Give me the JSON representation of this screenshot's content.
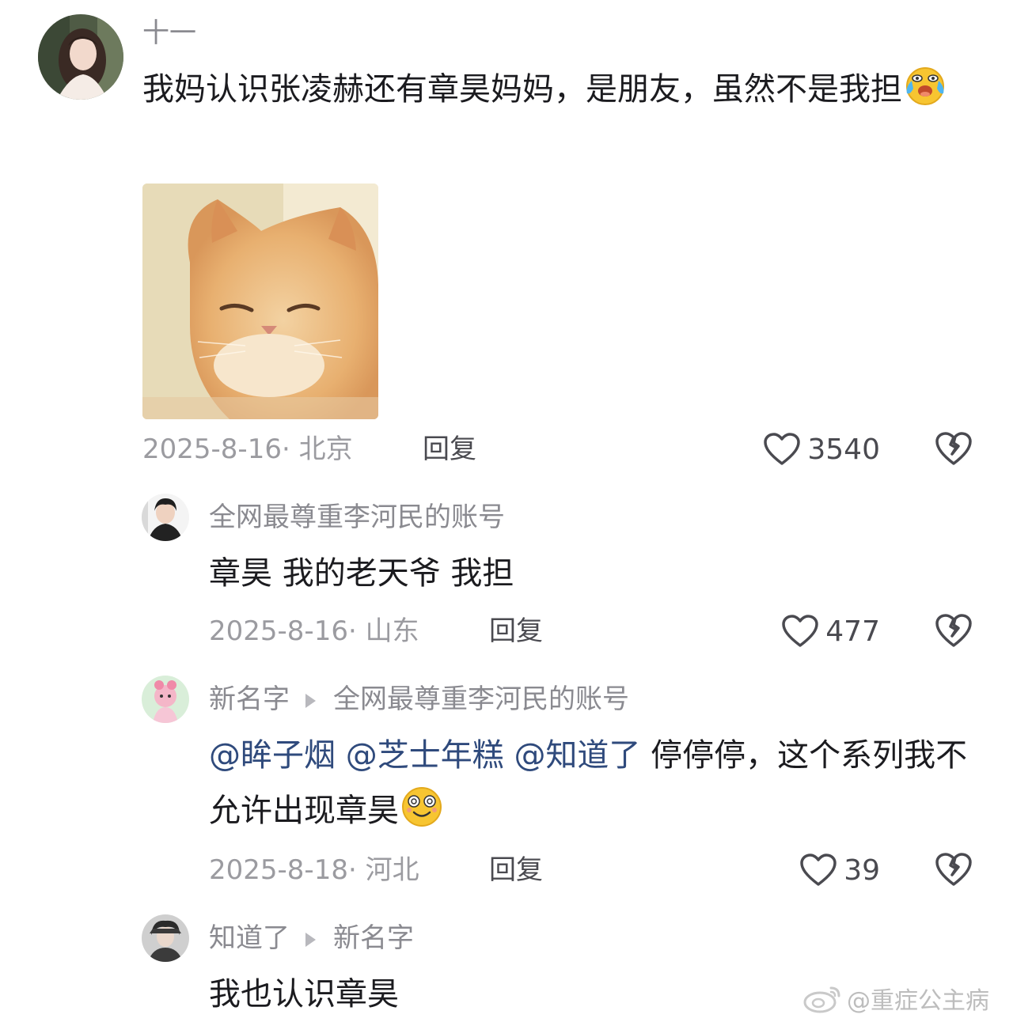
{
  "comments": [
    {
      "username": "十一",
      "text": "我妈认识张凌赫还有章昊妈妈，是朋友，虽然不是我担",
      "emoji": "crying-laughing-emoji",
      "date": "2025-8-16",
      "location": "北京",
      "reply_label": "回复",
      "likes": "3540",
      "image": "orange-cat-squinting-photo"
    },
    {
      "username": "全网最尊重李河民的账号",
      "text": "章昊 我的老天爷 我担",
      "date": "2025-8-16",
      "location": "山东",
      "reply_label": "回复",
      "likes": "477"
    },
    {
      "username": "新名字",
      "reply_to": "全网最尊重李河民的账号",
      "mentions": [
        "@眸子烟",
        "@芝士年糕",
        "@知道了"
      ],
      "text": "停停停，这个系列我不允许出现章昊",
      "emoji": "dizzy-smile-emoji",
      "date": "2025-8-18",
      "location": "河北",
      "reply_label": "回复",
      "likes": "39"
    },
    {
      "username": "知道了",
      "reply_to": "新名字",
      "text": "我也认识章昊"
    }
  ],
  "watermark": "@重症公主病",
  "icons": {
    "like": "heart-outline-icon",
    "dislike": "broken-heart-icon",
    "weibo": "weibo-logo-icon"
  },
  "colors": {
    "mention": "#2f4a7c",
    "meta": "#9b9ba0",
    "username": "#8a8a90"
  }
}
